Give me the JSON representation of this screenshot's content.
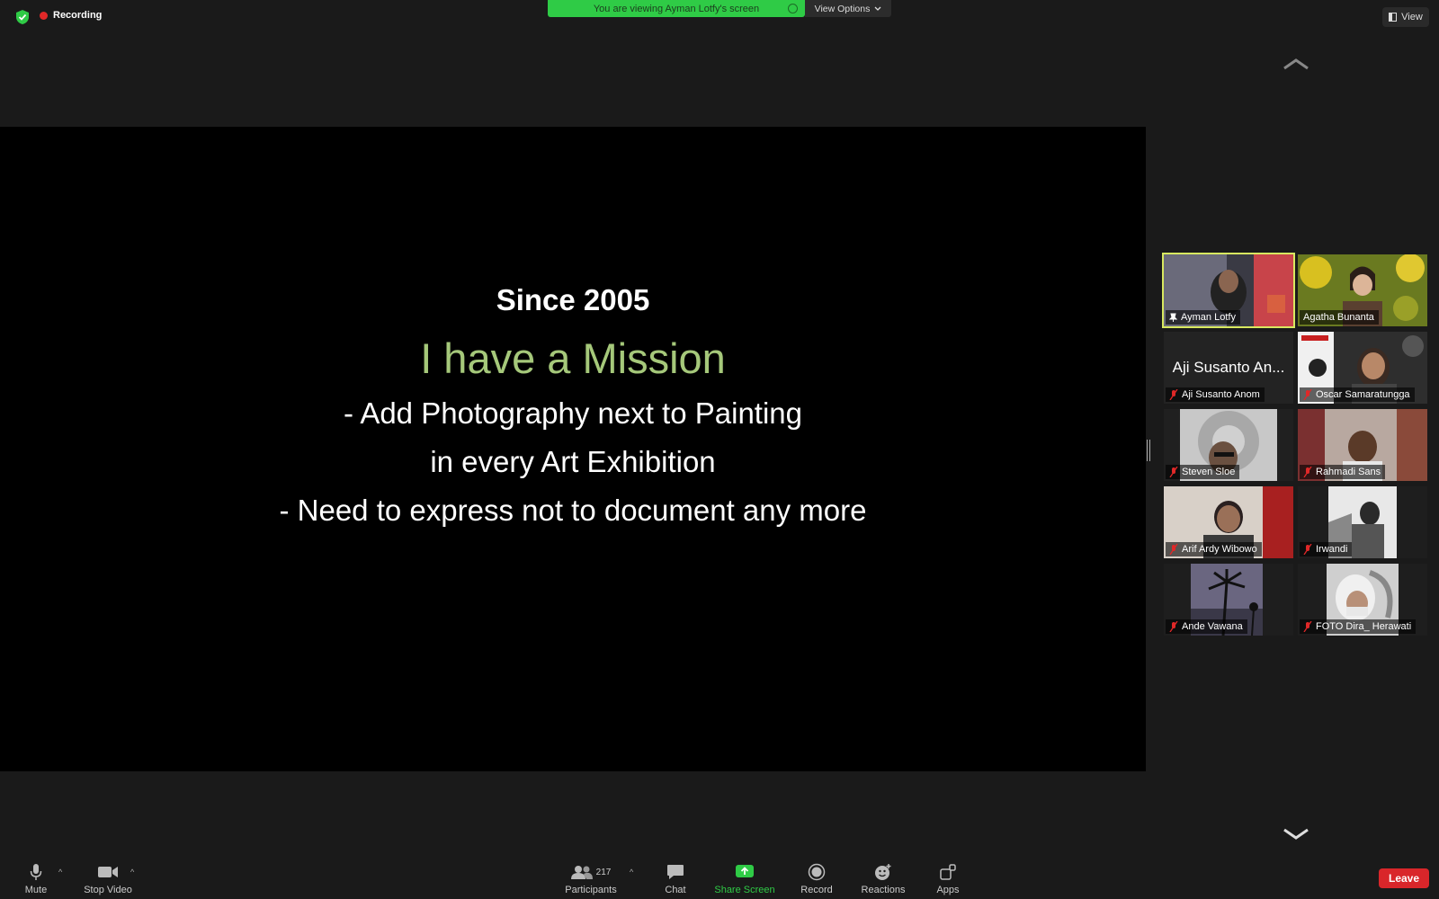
{
  "top_bar": {
    "recording_label": "Recording",
    "viewing_banner": "You are viewing Ayman Lotfy's screen",
    "view_options_label": "View Options",
    "view_button_label": "View"
  },
  "shared_slide": {
    "since": "Since 2005",
    "mission": "I have a Mission",
    "line1": "- Add Photography next to Painting",
    "line2": "in every Art Exhibition",
    "line3": "- Need to express not to document any more"
  },
  "gallery": {
    "tiles": [
      {
        "name": "Ayman Lotfy",
        "muted": false,
        "active": true
      },
      {
        "name": "Agatha Bunanta",
        "muted": false
      },
      {
        "name": "Aji Susanto Anom",
        "muted": true,
        "display_name": "Aji Susanto An..."
      },
      {
        "name": "Oscar Samaratungga",
        "muted": true
      },
      {
        "name": "Steven Sloe",
        "muted": true
      },
      {
        "name": "Rahmadi Sans",
        "muted": true
      },
      {
        "name": "Arif Ardy Wibowo",
        "muted": true
      },
      {
        "name": "Irwandi",
        "muted": true
      },
      {
        "name": "Ande Vawana",
        "muted": true
      },
      {
        "name": "FOTO Dira_ Herawati",
        "muted": true
      }
    ]
  },
  "toolbar": {
    "mute_label": "Mute",
    "stop_video_label": "Stop Video",
    "participants_label": "Participants",
    "participants_count": "217",
    "chat_label": "Chat",
    "share_screen_label": "Share Screen",
    "record_label": "Record",
    "reactions_label": "Reactions",
    "apps_label": "Apps",
    "leave_label": "Leave"
  },
  "colors": {
    "accent_green": "#2fcb46",
    "mission_green": "#a5c87a",
    "leave_red": "#d9262a",
    "active_speaker": "#d8e860"
  }
}
